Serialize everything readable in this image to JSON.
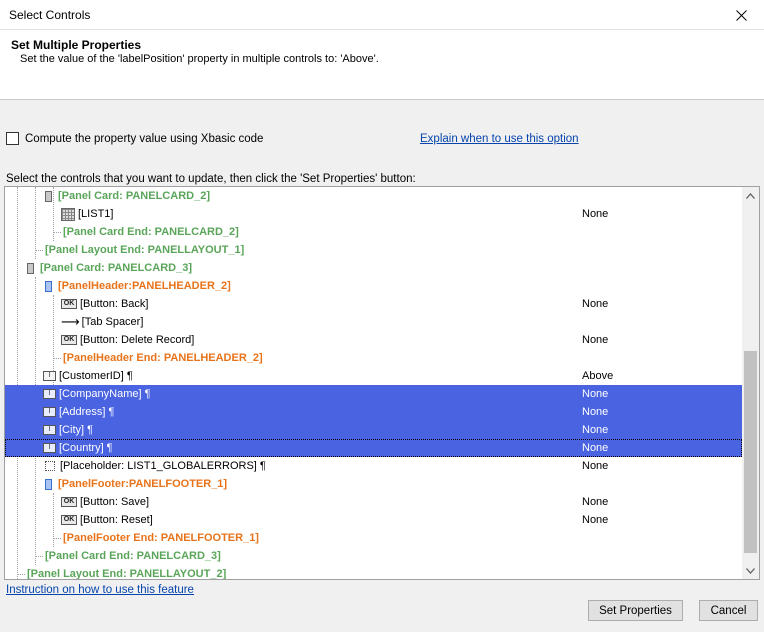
{
  "window": {
    "title": "Select Controls"
  },
  "header": {
    "title": "Set Multiple Properties",
    "description": "Set the value of the 'labelPosition' property in multiple controls to: 'Above'."
  },
  "options": {
    "compute_label": "Compute the property value using Xbasic code",
    "explain_link": "Explain when to use this option"
  },
  "instructions": "Select the controls that you want to update, then click the 'Set Properties' button:",
  "tree": {
    "rows": [
      {
        "label": "[Panel Card: PANELCARD_2]",
        "value": ""
      },
      {
        "label": "[LIST1]",
        "value": "None"
      },
      {
        "label": "[Panel Card End: PANELCARD_2]",
        "value": ""
      },
      {
        "label": "[Panel Layout End: PANELLAYOUT_1]",
        "value": ""
      },
      {
        "label": "[Panel Card: PANELCARD_3]",
        "value": ""
      },
      {
        "label": "[PanelHeader:PANELHEADER_2]",
        "value": ""
      },
      {
        "label": "[Button: Back]",
        "value": "None"
      },
      {
        "label": "[Tab Spacer]",
        "value": ""
      },
      {
        "label": "[Button: Delete Record]",
        "value": "None"
      },
      {
        "label": "[PanelHeader End: PANELHEADER_2]",
        "value": ""
      },
      {
        "label": "[CustomerID] ¶",
        "value": "Above"
      },
      {
        "label": "[CompanyName] ¶",
        "value": "None"
      },
      {
        "label": "[Address] ¶",
        "value": "None"
      },
      {
        "label": "[City] ¶",
        "value": "None"
      },
      {
        "label": "[Country] ¶",
        "value": "None"
      },
      {
        "label": "[Placeholder: LIST1_GLOBALERRORS] ¶",
        "value": "None"
      },
      {
        "label": "[PanelFooter:PANELFOOTER_1]",
        "value": ""
      },
      {
        "label": "[Button: Save]",
        "value": "None"
      },
      {
        "label": "[Button: Reset]",
        "value": "None"
      },
      {
        "label": "[PanelFooter End: PANELFOOTER_1]",
        "value": ""
      },
      {
        "label": "[Panel Card End: PANELCARD_3]",
        "value": ""
      },
      {
        "label": "[Panel Layout End: PANELLAYOUT_2]",
        "value": ""
      }
    ]
  },
  "icon_text": {
    "button_icon": "OK",
    "field_icon": "I"
  },
  "footer": {
    "instruction_link": "Instruction on how to use this feature",
    "set_button": "Set Properties",
    "cancel_button": "Cancel"
  },
  "colors": {
    "selection": "#4a63e0",
    "panel_text": "#5aa55a",
    "header_text": "#e8731a",
    "link": "#0645ad"
  }
}
